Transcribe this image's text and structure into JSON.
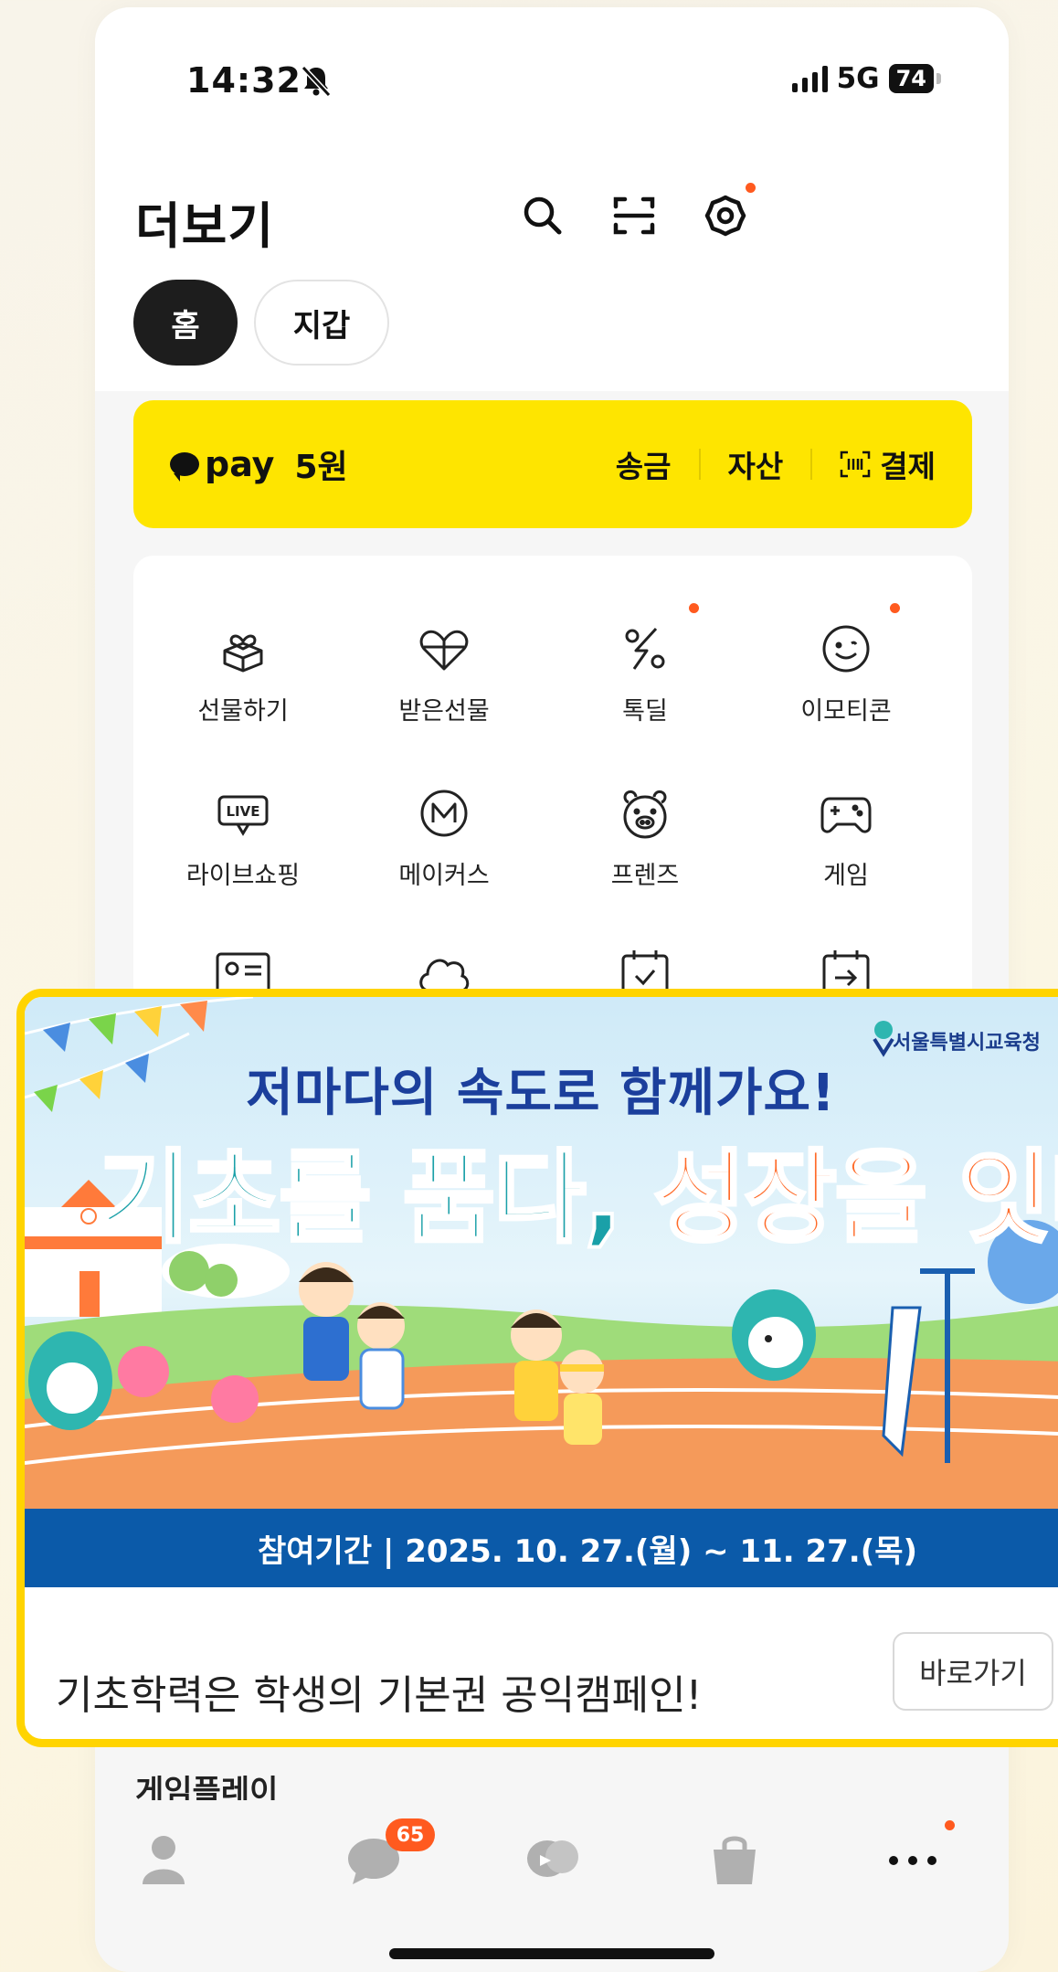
{
  "status": {
    "time": "14:32",
    "network": "5G",
    "battery": "74"
  },
  "header": {
    "title": "더보기"
  },
  "tabs": {
    "home": "홈",
    "wallet": "지갑"
  },
  "pay": {
    "logo": "pay",
    "amount": "5원",
    "actions": {
      "send": "송금",
      "assets": "자산",
      "payment": "결제"
    }
  },
  "services": [
    {
      "label": "선물하기",
      "icon": "gift-icon"
    },
    {
      "label": "받은선물",
      "icon": "received-gift-icon"
    },
    {
      "label": "톡딜",
      "icon": "talk-deal-icon"
    },
    {
      "label": "이모티콘",
      "icon": "emoticon-icon"
    },
    {
      "label": "라이브쇼핑",
      "icon": "live-shopping-icon"
    },
    {
      "label": "메이커스",
      "icon": "makers-icon"
    },
    {
      "label": "프렌즈",
      "icon": "friends-icon"
    },
    {
      "label": "게임",
      "icon": "game-icon"
    }
  ],
  "banner": {
    "org": "서울특별시교육청",
    "headline_top": "저마다의 속도로 함께가요!",
    "headline_a": "기초를 품다,",
    "headline_b": "성장을 잇다",
    "period": "참여기간 | 2025. 10. 27.(월) ~ 11. 27.(목)",
    "text": "기초학력은 학생의 기본권 공익캠페인!",
    "button": "바로가기"
  },
  "section_peek": "게임플레이",
  "tabbar": {
    "chat_badge": "65"
  },
  "colors": {
    "kakao_yellow": "#fee500",
    "badge": "#ff5a1f",
    "period_bar": "#0b5aa9"
  }
}
